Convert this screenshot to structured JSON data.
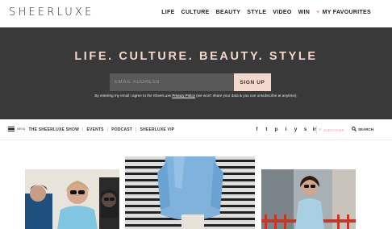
{
  "header": {
    "logo": "SHEERLUXE",
    "nav": [
      "LIFE",
      "CULTURE",
      "BEAUTY",
      "STYLE",
      "VIDEO",
      "WIN"
    ],
    "favourites": "MY FAVOURITES"
  },
  "hero": {
    "tagline": "LIFE. CULTURE. BEAUTY. STYLE",
    "email_placeholder": "EMAIL ADDRESS",
    "signup": "SIGN UP",
    "disclaimer_pre": "By entering my email I agree to the SheerLuxe ",
    "disclaimer_link": "Privacy Policy",
    "disclaimer_post": " (we won't share your data & you can unsubscribe at anytime)."
  },
  "subnav": {
    "menu_label": "MENU",
    "links": [
      "THE SHEERLUXE SHOW",
      "EVENTS",
      "PODCAST",
      "SHEERLUXE VIP"
    ],
    "social": [
      "f",
      "t",
      "p",
      "i",
      "y",
      "s",
      "in"
    ],
    "subscribe": "SUBSCRIBE",
    "search": "SEARCH"
  },
  "colors": {
    "hero_bg": "#3a3939",
    "accent_pink": "#f3d6cc",
    "heart": "#e7a9b0"
  }
}
